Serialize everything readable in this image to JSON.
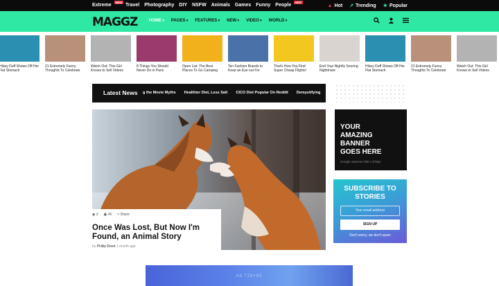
{
  "topbar": {
    "links": [
      {
        "label": "Extreme",
        "badge": "NEW"
      },
      {
        "label": "Travel",
        "badge": ""
      },
      {
        "label": "Photography",
        "badge": ""
      },
      {
        "label": "DIY",
        "badge": ""
      },
      {
        "label": "NSFW",
        "badge": ""
      },
      {
        "label": "Animals",
        "badge": ""
      },
      {
        "label": "Games",
        "badge": ""
      },
      {
        "label": "Funny",
        "badge": ""
      },
      {
        "label": "People",
        "badge": "HOT"
      }
    ],
    "right": [
      {
        "label": "Hot",
        "icon": "fire-icon",
        "color": "#e83a4a"
      },
      {
        "label": "Trending",
        "icon": "trending-icon",
        "color": "#2fe8a4"
      },
      {
        "label": "Popular",
        "icon": "star-icon",
        "color": "#2fe8a4"
      }
    ]
  },
  "nav": {
    "logo": "MAGGZ",
    "menu": [
      "HOME",
      "PAGES",
      "FEATURES",
      "NEW",
      "VIDEO",
      "WORLD"
    ],
    "active": "HOME",
    "accent": "#2fe8a4"
  },
  "strip": [
    {
      "caption": "Hilary Duff Shows Off Her Flat Stomach",
      "color": "#2a8fb0"
    },
    {
      "caption": "21 Extremely Funny Thoughts To Celebrate",
      "color": "#b9907a"
    },
    {
      "caption": "Watch Out: This Girl Knows to Sell Videos",
      "color": "#b3b3b3"
    },
    {
      "caption": "8 Things You Should Never Do in Paris",
      "color": "#9b3a6c"
    },
    {
      "caption": "Open List: The Best Places To Go Camping",
      "color": "#f0b11a"
    },
    {
      "caption": "Ten Fashion Brands to Keep an Eye out For",
      "color": "#4a72a8"
    },
    {
      "caption": "That's How You Find Super Cheap Flights!",
      "color": "#f2c820"
    },
    {
      "caption": "End Your Nightly Snoring Nightmare",
      "color": "#d9d4cf"
    },
    {
      "caption": "Hilary Duff Shows Off Her Flat Stomach",
      "color": "#2a8fb0"
    },
    {
      "caption": "21 Extremely Funny Thoughts To Celebrate",
      "color": "#b9907a"
    },
    {
      "caption": "Watch Out: This Girl Knows to Sell Videos",
      "color": "#b3b3b3"
    }
  ],
  "ticker": {
    "label": "Latest News",
    "items": [
      "g the Movie Myths",
      "Healthier Diet, Less Salt",
      "CICO Diet Popular On Reddit",
      "Demystifying"
    ]
  },
  "hero": {
    "views": "3",
    "comments": "46",
    "share": "Share",
    "title": "Once Was Lost, But Now I'm Found, an Animal Story",
    "author_prefix": "by",
    "author": "Phillip Reed",
    "time": "1 month ago"
  },
  "banner": {
    "text": "YOUR AMAZING BANNER GOES HERE",
    "footer": "Google adsense  360 x 576px"
  },
  "subscribe": {
    "title": "SUBSCRIBE TO STORIES",
    "placeholder": "Your email address",
    "button": "SIGN UP",
    "note": "Don't worry, we don't spam"
  },
  "bottom_ad": {
    "text": "Ad 728×90"
  }
}
